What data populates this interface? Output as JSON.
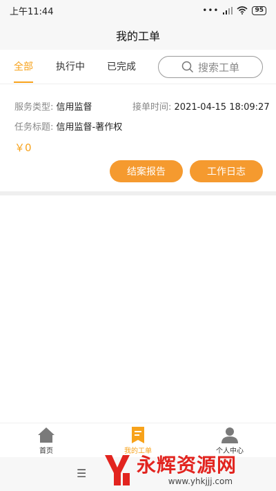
{
  "status_bar": {
    "time": "上午11:44",
    "battery": "95"
  },
  "header": {
    "title": "我的工单"
  },
  "tabs": [
    {
      "label": "全部",
      "active": true
    },
    {
      "label": "执行中",
      "active": false
    },
    {
      "label": "已完成",
      "active": false
    }
  ],
  "search": {
    "placeholder": "搜索工单"
  },
  "order": {
    "service_type_label": "服务类型:",
    "service_type": "信用监督",
    "accept_time_label": "接单时间:",
    "accept_time": "2021-04-15 18:09:27",
    "task_title_label": "任务标题:",
    "task_title": "信用监督-著作权",
    "price": "￥0",
    "btn_report": "结案报告",
    "btn_log": "工作日志"
  },
  "bottom_nav": [
    {
      "label": "首页",
      "icon": "home-icon",
      "active": false
    },
    {
      "label": "我的工单",
      "icon": "bookmark-icon",
      "active": true
    },
    {
      "label": "个人中心",
      "icon": "person-icon",
      "active": false
    }
  ],
  "watermark": {
    "title": "永辉资源网",
    "url": "www.yhkjjj.com"
  },
  "colors": {
    "accent": "#f7a21b",
    "button": "#f59a2f",
    "watermark": "#e2241f"
  }
}
